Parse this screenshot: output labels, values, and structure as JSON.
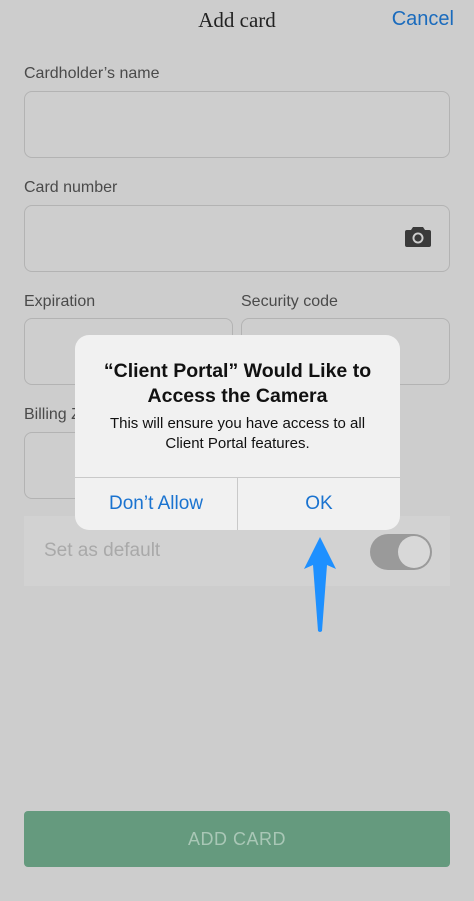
{
  "nav": {
    "title": "Add card",
    "cancel": "Cancel"
  },
  "form": {
    "cardholder_label": "Cardholder’s name",
    "card_number_label": "Card number",
    "expiration_label": "Expiration",
    "security_label": "Security code",
    "billing_label": "Billing Z",
    "default_label": "Set as default",
    "default_on": true,
    "submit_label": "ADD CARD"
  },
  "dialog": {
    "title_line1": "“Client Portal” Would Like to",
    "title_line2": "Access the Camera",
    "message_line1": "This will ensure you have access to all",
    "message_line2": "Client Portal features.",
    "deny_label": "Don’t Allow",
    "ok_label": "OK"
  },
  "colors": {
    "accent": "#1a73d0",
    "primary_button": "#659a7e",
    "annotation_arrow": "#1e90ff"
  }
}
